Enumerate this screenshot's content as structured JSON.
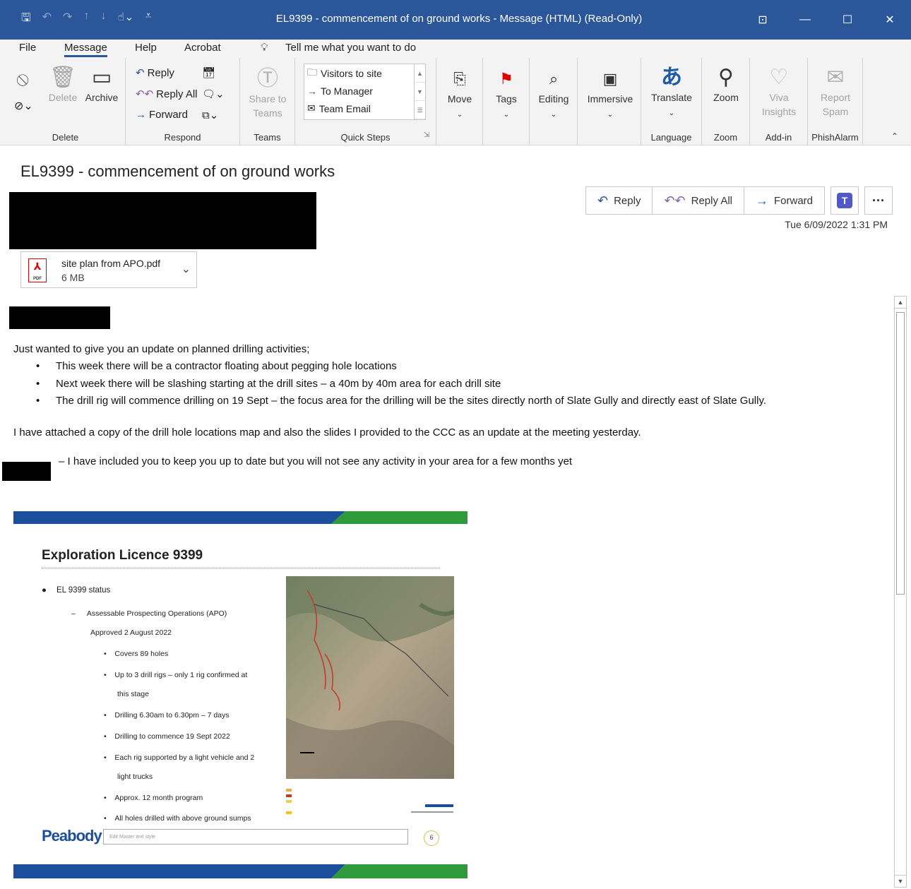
{
  "window": {
    "title": "EL9399 - commencement of on ground works  -  Message (HTML) (Read-Only)",
    "qat_icons": [
      "save-icon",
      "undo-icon",
      "redo-icon",
      "up-icon",
      "down-icon",
      "touch-mode-icon",
      "customize-icon"
    ],
    "controls": [
      "ribbon-display-icon",
      "minimize-icon",
      "maximize-icon",
      "close-icon"
    ]
  },
  "menu": {
    "tabs": [
      "File",
      "Message",
      "Help",
      "Acrobat"
    ],
    "active": "Message",
    "tellme": "Tell me what you want to do"
  },
  "ribbon": {
    "delete": {
      "label": "Delete",
      "delete_btn": "Delete",
      "archive_btn": "Archive"
    },
    "respond": {
      "label": "Respond",
      "reply": "Reply",
      "reply_all": "Reply All",
      "forward": "Forward"
    },
    "teams": {
      "label": "Teams",
      "share_line1": "Share to",
      "share_line2": "Teams"
    },
    "quick_steps": {
      "label": "Quick Steps",
      "items": [
        "Visitors to site",
        "To Manager",
        "Team Email"
      ]
    },
    "move": {
      "label": "Move"
    },
    "tags": {
      "label": "Tags"
    },
    "editing": {
      "label": "Editing"
    },
    "immersive": {
      "label": "Immersive"
    },
    "language": {
      "label": "Language",
      "translate": "Translate"
    },
    "zoom": {
      "label": "Zoom",
      "zoom_btn": "Zoom"
    },
    "addin": {
      "label": "Add-in",
      "viva_line1": "Viva",
      "viva_line2": "Insights"
    },
    "phish": {
      "label": "PhishAlarm",
      "report_line1": "Report",
      "report_line2": "Spam"
    }
  },
  "message": {
    "subject": "EL9399 - commencement of on ground works",
    "actions": {
      "reply": "Reply",
      "reply_all": "Reply All",
      "forward": "Forward"
    },
    "sent": "Tue 6/09/2022 1:31 PM",
    "attachment": {
      "name": "site plan from APO.pdf",
      "size": "6 MB",
      "type": "PDF"
    },
    "body": {
      "intro": "Just wanted to give you an update on planned drilling activities;",
      "bullets": [
        "This week there will be a contractor floating about pegging hole locations",
        "Next week there will be slashing starting at the drill sites – a 40m by 40m area for each drill site",
        "The drill rig will commence drilling on 19 Sept – the focus area for the drilling will be the sites directly north of Slate Gully and directly east of Slate Gully."
      ],
      "para2": "I have attached a copy of the drill hole locations map and also the slides I provided to the CCC as an update at the meeting yesterday.",
      "para3": "– I have included you to keep you up to date but you will not see any activity in your area for a few months yet"
    }
  },
  "slide": {
    "title": "Exploration Licence 9399",
    "status": "EL 9399 status",
    "apo_line1": "Assessable Prospecting Operations (APO)",
    "apo_line2": "Approved 2 August 2022",
    "items": {
      "a": "Covers 89 holes",
      "b1": "Up to 3 drill rigs – only 1 rig confirmed at",
      "b2": "this stage",
      "c": "Drilling 6.30am to 6.30pm – 7 days",
      "d": "Drilling to commence 19 Sept 2022",
      "e1": "Each rig supported by a light vehicle and 2",
      "e2": "light trucks",
      "f": "Approx. 12 month program",
      "g": "All holes drilled with above ground sumps"
    },
    "footer_logo": "Peabody",
    "footer_placeholder": "Edit Master text style",
    "page": "6",
    "colors": {
      "blue": "#1b4f9c",
      "green": "#2e9a3c"
    }
  }
}
